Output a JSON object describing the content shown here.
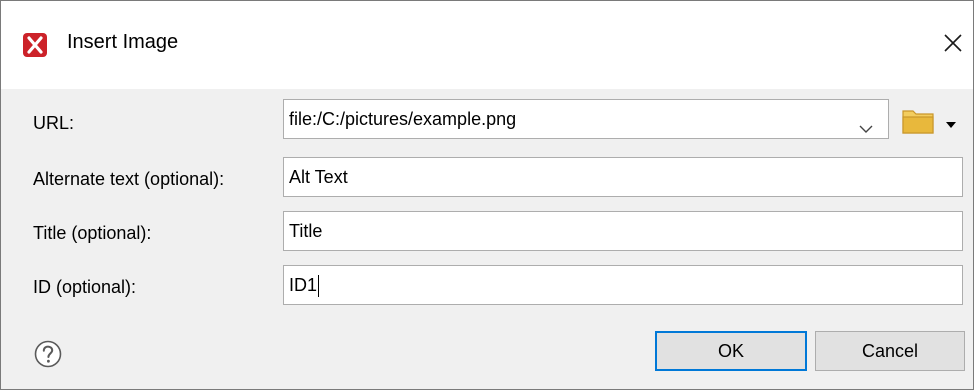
{
  "window": {
    "title": "Insert Image",
    "app_icon": "oxygen-x-icon",
    "close_icon": "close-icon"
  },
  "form": {
    "url": {
      "label": "URL:",
      "value": "file:/C:/pictures/example.png",
      "dropdown_icon": "chevron-down-icon",
      "browse_icon": "folder-icon"
    },
    "alt": {
      "label": "Alternate text (optional):",
      "value": "Alt Text"
    },
    "title": {
      "label": "Title (optional):",
      "value": "Title"
    },
    "id": {
      "label": "ID (optional):",
      "value": "ID1"
    }
  },
  "footer": {
    "help_icon": "help-icon",
    "ok_label": "OK",
    "cancel_label": "Cancel"
  },
  "colors": {
    "accent": "#0078d7",
    "app_icon": "#cc2229",
    "folder": "#e8b83c"
  }
}
